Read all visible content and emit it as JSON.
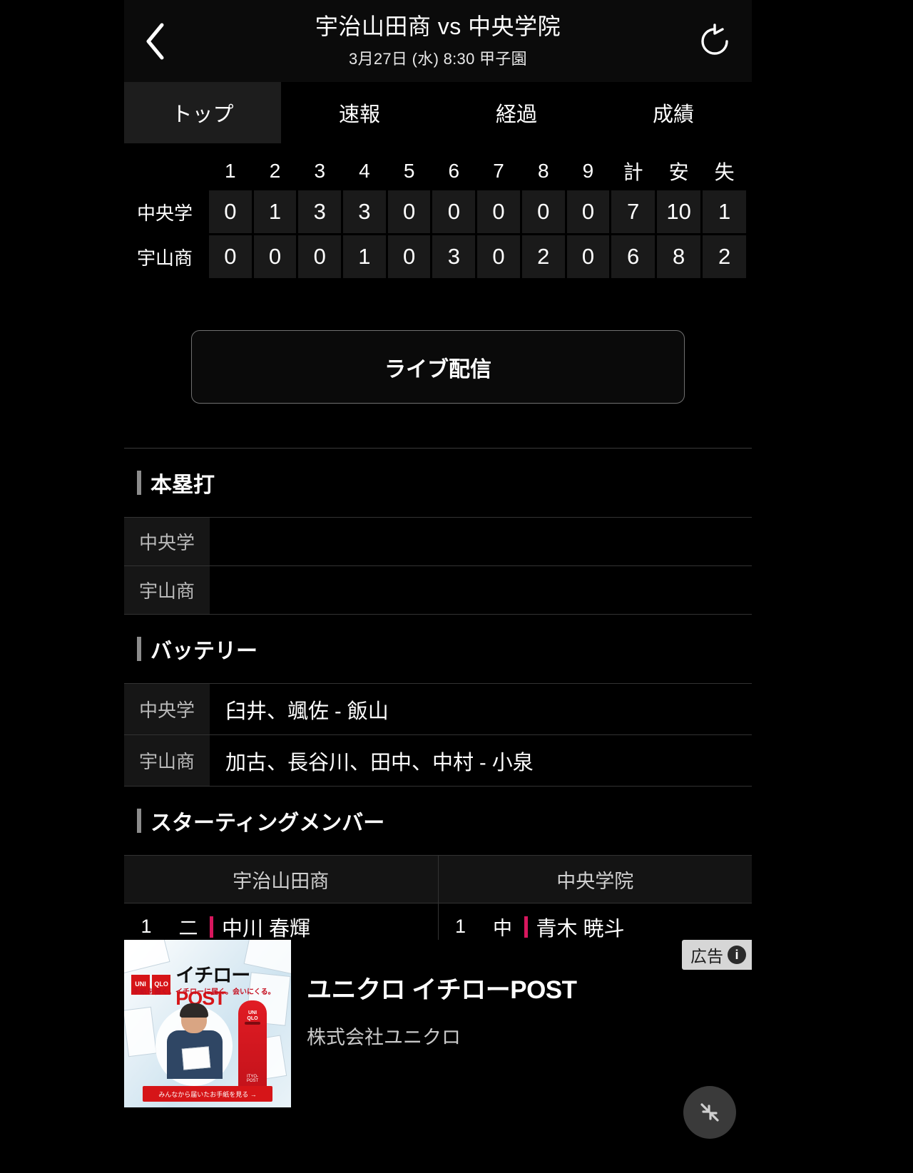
{
  "header": {
    "title": "宇治山田商 vs 中央学院",
    "subtitle": "3月27日 (水) 8:30 甲子園",
    "back_icon": "chevron-left-icon",
    "refresh_icon": "refresh-icon"
  },
  "tabs": [
    {
      "label": "トップ",
      "active": true
    },
    {
      "label": "速報",
      "active": false
    },
    {
      "label": "経過",
      "active": false
    },
    {
      "label": "成績",
      "active": false
    }
  ],
  "scoreboard": {
    "innings": [
      "1",
      "2",
      "3",
      "4",
      "5",
      "6",
      "7",
      "8",
      "9"
    ],
    "summary_headers": [
      "計",
      "安",
      "失"
    ],
    "rows": [
      {
        "team": "中央学",
        "innings": [
          "0",
          "1",
          "3",
          "3",
          "0",
          "0",
          "0",
          "0",
          "0"
        ],
        "runs": "7",
        "hits": "10",
        "errors": "1"
      },
      {
        "team": "宇山商",
        "innings": [
          "0",
          "0",
          "0",
          "1",
          "0",
          "3",
          "0",
          "2",
          "0"
        ],
        "runs": "6",
        "hits": "8",
        "errors": "2"
      }
    ]
  },
  "live_button": {
    "label": "ライブ配信"
  },
  "sections": {
    "homeruns": {
      "title": "本塁打",
      "rows": [
        {
          "team": "中央学",
          "value": ""
        },
        {
          "team": "宇山商",
          "value": ""
        }
      ]
    },
    "battery": {
      "title": "バッテリー",
      "rows": [
        {
          "team": "中央学",
          "value": "臼井、颯佐 - 飯山"
        },
        {
          "team": "宇山商",
          "value": "加古、長谷川、田中、中村 - 小泉"
        }
      ]
    },
    "starting_members": {
      "title": "スターティングメンバー",
      "columns": [
        "宇治山田商",
        "中央学院"
      ],
      "home_lineup": [
        {
          "order": "1",
          "position": "二",
          "name": "中川 春輝"
        }
      ],
      "away_lineup": [
        {
          "order": "1",
          "position": "中",
          "name": "青木 暁斗"
        }
      ],
      "accent_color": "#d8175e"
    }
  },
  "ad": {
    "badge_label": "広告",
    "badge_icon": "info-icon",
    "title": "ユニクロ イチローPOST",
    "sponsor": "株式会社ユニクロ",
    "creative": {
      "brand_top": "UNI",
      "brand_bottom": "QLO",
      "logo_text_1": "イチロー",
      "logo_text_2": "POST",
      "tagline": "手紙を書く。イチローに届く。会いにくる。",
      "cta": "みんなから届いたお手紙を見る →",
      "post_label_top": "UNI QLO",
      "post_label_bottom": "ITYO-POST"
    }
  },
  "fab": {
    "icon": "collapse-arrows-icon"
  }
}
